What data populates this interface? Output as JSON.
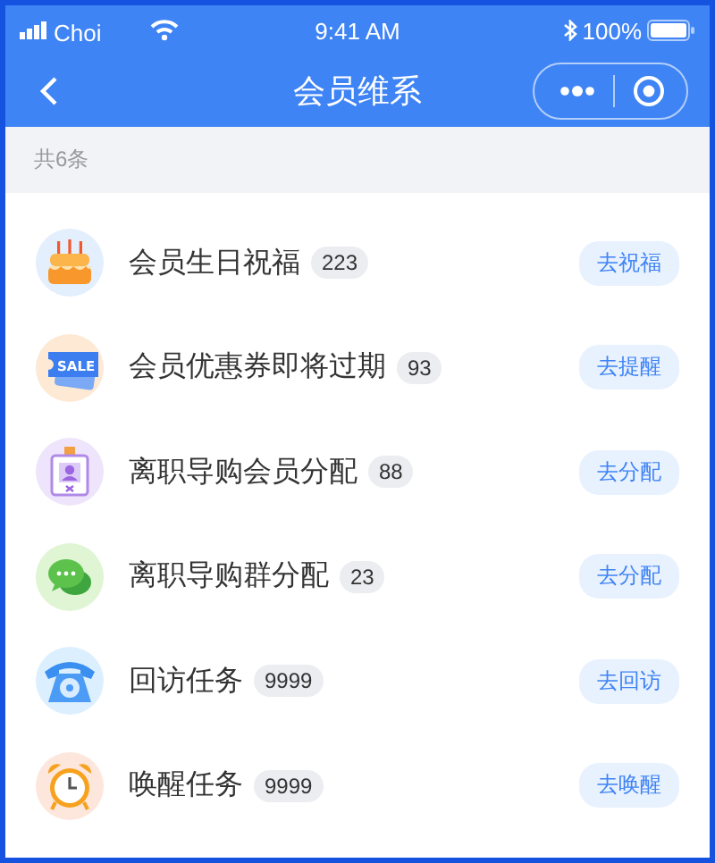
{
  "status_bar": {
    "carrier": "Choi",
    "time": "9:41 AM",
    "battery": "100%"
  },
  "nav": {
    "title": "会员维系"
  },
  "summary": "共6条",
  "items": [
    {
      "kind": "cake",
      "title": "会员生日祝福",
      "count": "223",
      "action": "去祝福"
    },
    {
      "kind": "coupon",
      "icon_text": "SALE",
      "title": "会员优惠券即将过期",
      "count": "93",
      "action": "去提醒"
    },
    {
      "kind": "badge",
      "title": "离职导购会员分配",
      "count": "88",
      "action": "去分配"
    },
    {
      "kind": "chat",
      "title": "离职导购群分配",
      "count": "23",
      "action": "去分配"
    },
    {
      "kind": "phone",
      "title": "回访任务",
      "count": "9999",
      "action": "去回访"
    },
    {
      "kind": "clock",
      "title": "唤醒任务",
      "count": "9999",
      "action": "去唤醒"
    }
  ]
}
